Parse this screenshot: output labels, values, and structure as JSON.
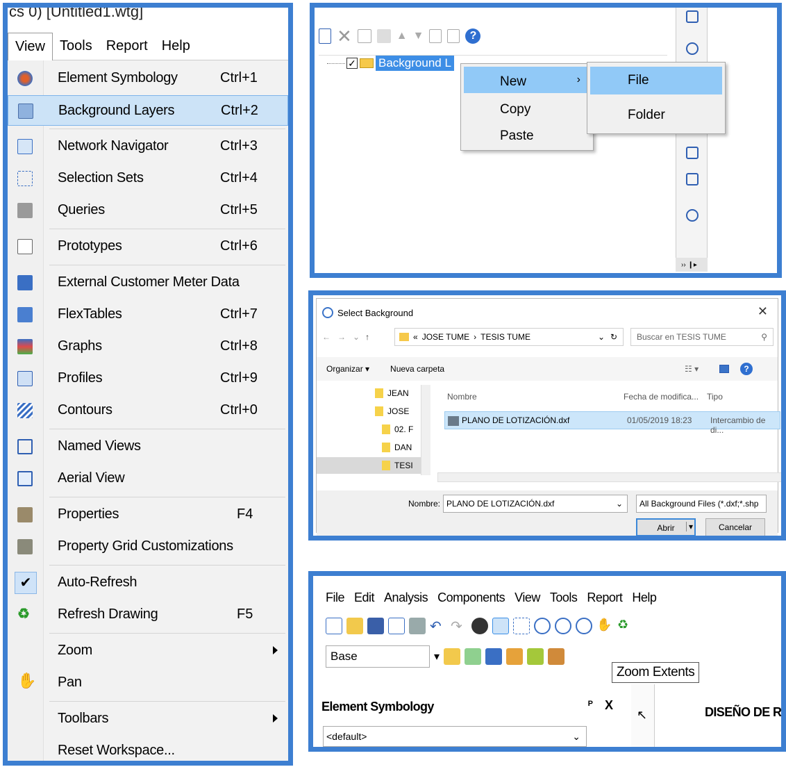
{
  "view_menu_panel": {
    "title_fragment": "cs 0) [Untitled1.wtg]",
    "menubar": [
      "View",
      "Tools",
      "Report",
      "Help"
    ],
    "items": [
      {
        "label": "Element Symbology",
        "shortcut": "Ctrl+1",
        "icon": "element-symbology-icon"
      },
      {
        "label": "Background Layers",
        "shortcut": "Ctrl+2",
        "icon": "background-layers-icon"
      },
      {
        "label": "Network Navigator",
        "shortcut": "Ctrl+3",
        "icon": "network-navigator-icon"
      },
      {
        "label": "Selection Sets",
        "shortcut": "Ctrl+4",
        "icon": "selection-sets-icon"
      },
      {
        "label": "Queries",
        "shortcut": "Ctrl+5",
        "icon": "queries-icon"
      },
      {
        "label": "Prototypes",
        "shortcut": "Ctrl+6",
        "icon": "prototypes-icon"
      },
      {
        "label": "External Customer Meter Data",
        "shortcut": "",
        "icon": "customer-meter-icon"
      },
      {
        "label": "FlexTables",
        "shortcut": "Ctrl+7",
        "icon": "flextables-icon"
      },
      {
        "label": "Graphs",
        "shortcut": "Ctrl+8",
        "icon": "graphs-icon"
      },
      {
        "label": "Profiles",
        "shortcut": "Ctrl+9",
        "icon": "profiles-icon"
      },
      {
        "label": "Contours",
        "shortcut": "Ctrl+0",
        "icon": "contours-icon"
      },
      {
        "label": "Named Views",
        "shortcut": "",
        "icon": "named-views-icon"
      },
      {
        "label": "Aerial View",
        "shortcut": "",
        "icon": "aerial-view-icon"
      },
      {
        "label": "Properties",
        "shortcut": "F4",
        "icon": "properties-icon"
      },
      {
        "label": "Property Grid Customizations",
        "shortcut": "",
        "icon": "property-grid-icon"
      },
      {
        "label": "Auto-Refresh",
        "shortcut": "",
        "icon": "check-icon"
      },
      {
        "label": "Refresh Drawing",
        "shortcut": "F5",
        "icon": "refresh-icon"
      },
      {
        "label": "Zoom",
        "shortcut": "",
        "icon": ""
      },
      {
        "label": "Pan",
        "shortcut": "",
        "icon": "pan-hand-icon"
      },
      {
        "label": "Toolbars",
        "shortcut": "",
        "icon": ""
      },
      {
        "label": "Reset Workspace...",
        "shortcut": "",
        "icon": ""
      }
    ],
    "highlighted": "Background Layers"
  },
  "tree_panel": {
    "node_label": "Background L",
    "context_menu": [
      "New",
      "Copy",
      "Paste"
    ],
    "submenu": [
      "File",
      "Folder"
    ]
  },
  "dialog_panel": {
    "title": "Select Background",
    "breadcrumb_prefix": "«",
    "path": [
      "JOSE TUME",
      "TESIS TUME"
    ],
    "search_placeholder": "Buscar en TESIS TUME",
    "organize": "Organizar ▾",
    "new_folder": "Nueva carpeta",
    "nav_items": [
      "JEAN",
      "JOSE",
      "02. F",
      "DAN",
      "TESI"
    ],
    "columns": [
      "Nombre",
      "Fecha de modifica...",
      "Tipo"
    ],
    "file": {
      "name": "PLANO DE LOTIZACIÓN.dxf",
      "date": "01/05/2019 18:23",
      "type": "Intercambio de di..."
    },
    "name_label": "Nombre:",
    "name_value": "PLANO DE LOTIZACIÓN.dxf",
    "filter": "All Background Files (*.dxf;*.shp",
    "open_button": "Abrir",
    "cancel_button": "Cancelar"
  },
  "app_panel": {
    "menubar": [
      "File",
      "Edit",
      "Analysis",
      "Components",
      "View",
      "Tools",
      "Report",
      "Help"
    ],
    "combo_value": "Base",
    "tooltip": "Zoom Extents",
    "dock_title": "Element Symbology",
    "pin": "ᴾ",
    "close": "X",
    "default_combo": "<default>",
    "doc_tab": "DISEÑO DE RED"
  },
  "colors": {
    "panel_border": "#3d7fd1",
    "highlight": "#cce3f7",
    "selection": "#3d8ee6"
  }
}
